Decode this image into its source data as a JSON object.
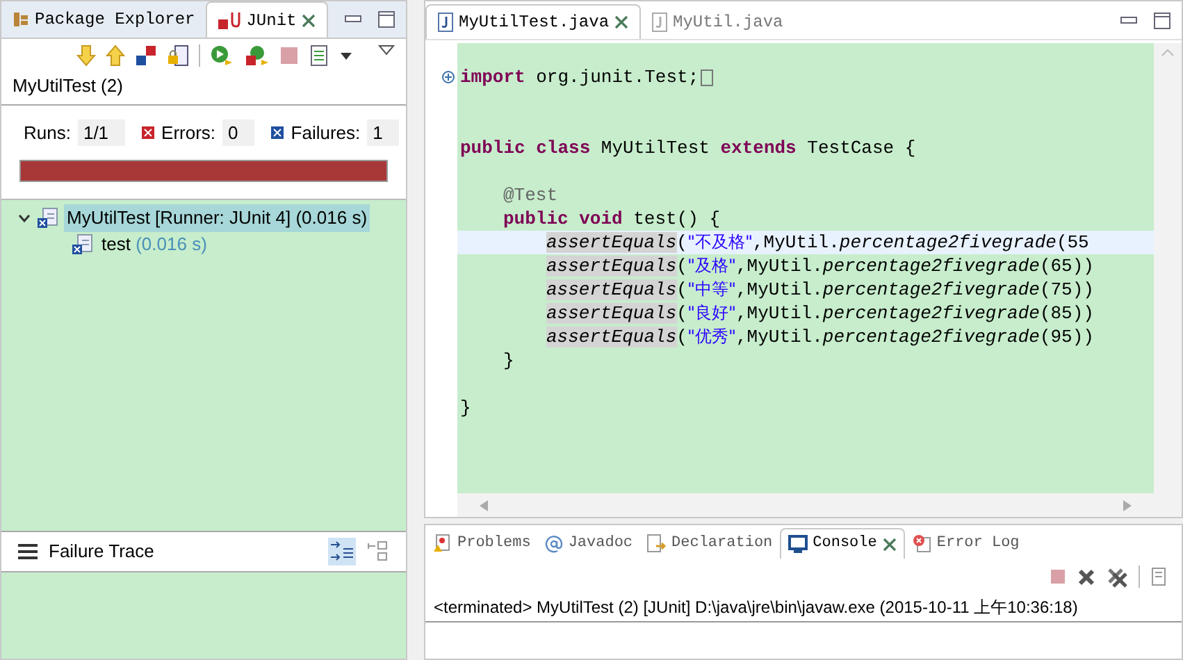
{
  "left_tabs": [
    {
      "label": "Package Explorer",
      "selected": false,
      "kind": "package"
    },
    {
      "label": "JUnit",
      "selected": true,
      "kind": "junit"
    }
  ],
  "junit": {
    "title": "MyUtilTest (2)",
    "counters": [
      {
        "label": "Runs:",
        "value": "1/1",
        "kind": "plain"
      },
      {
        "label": "Errors:",
        "value": "0",
        "kind": "error"
      },
      {
        "label": "Failures:",
        "value": "1",
        "kind": "failure"
      }
    ],
    "progress": {
      "level": 1,
      "failed": true
    },
    "tree": [
      {
        "label": "MyUtilTest [Runner: JUnit 4] (0.016 s)",
        "selected": true,
        "expanded": true,
        "children": [
          {
            "label": "test",
            "time": "(0.016 s)",
            "selected": false
          }
        ]
      }
    ],
    "failure_trace": {
      "title": "Failure Trace"
    }
  },
  "editor_tabs": [
    {
      "label": "MyUtilTest.java",
      "selected": true
    },
    {
      "label": "MyUtil.java",
      "selected": false
    }
  ],
  "code_lines": [
    {
      "kind": "code",
      "current": false,
      "folded": true,
      "tokens": [
        {
          "text": "import",
          "kind": "keyword"
        },
        {
          "text": " org.junit.Test;",
          "kind": "plain"
        }
      ]
    },
    {
      "kind": "blank"
    },
    {
      "kind": "blank"
    },
    {
      "kind": "code",
      "current": false,
      "tokens": [
        {
          "text": "public class",
          "kind": "keyword"
        },
        {
          "text": " MyUtilTest ",
          "kind": "plain"
        },
        {
          "text": "extends",
          "kind": "keyword"
        },
        {
          "text": " TestCase {",
          "kind": "plain"
        }
      ],
      "children": [
        {
          "kind": "blank"
        },
        {
          "kind": "code",
          "current": false,
          "tokens": [
            {
              "text": "@Test",
              "kind": "annotation"
            }
          ]
        },
        {
          "kind": "code",
          "current": false,
          "tokens": [
            {
              "text": "public void",
              "kind": "keyword"
            },
            {
              "text": " test() {",
              "kind": "plain"
            }
          ],
          "children": [
            {
              "kind": "code",
              "current": true,
              "tokens": [
                {
                  "text": "assertEquals",
                  "kind": "static"
                },
                {
                  "text": "(",
                  "kind": "plain"
                },
                {
                  "text": "\"不及格\"",
                  "kind": "string"
                },
                {
                  "text": ",MyUtil.",
                  "kind": "plain"
                },
                {
                  "text": "percentage2fivegrade",
                  "kind": "method"
                },
                {
                  "text": "(55",
                  "kind": "plain"
                }
              ]
            },
            {
              "kind": "code",
              "current": false,
              "tokens": [
                {
                  "text": "assertEquals",
                  "kind": "static"
                },
                {
                  "text": "(",
                  "kind": "plain"
                },
                {
                  "text": "\"及格\"",
                  "kind": "string"
                },
                {
                  "text": ",MyUtil.",
                  "kind": "plain"
                },
                {
                  "text": "percentage2fivegrade",
                  "kind": "method"
                },
                {
                  "text": "(65))",
                  "kind": "plain"
                }
              ]
            },
            {
              "kind": "code",
              "current": false,
              "tokens": [
                {
                  "text": "assertEquals",
                  "kind": "static"
                },
                {
                  "text": "(",
                  "kind": "plain"
                },
                {
                  "text": "\"中等\"",
                  "kind": "string"
                },
                {
                  "text": ",MyUtil.",
                  "kind": "plain"
                },
                {
                  "text": "percentage2fivegrade",
                  "kind": "method"
                },
                {
                  "text": "(75))",
                  "kind": "plain"
                }
              ]
            },
            {
              "kind": "code",
              "current": false,
              "tokens": [
                {
                  "text": "assertEquals",
                  "kind": "static"
                },
                {
                  "text": "(",
                  "kind": "plain"
                },
                {
                  "text": "\"良好\"",
                  "kind": "string"
                },
                {
                  "text": ",MyUtil.",
                  "kind": "plain"
                },
                {
                  "text": "percentage2fivegrade",
                  "kind": "method"
                },
                {
                  "text": "(85))",
                  "kind": "plain"
                }
              ]
            },
            {
              "kind": "code",
              "current": false,
              "tokens": [
                {
                  "text": "assertEquals",
                  "kind": "static"
                },
                {
                  "text": "(",
                  "kind": "plain"
                },
                {
                  "text": "\"优秀\"",
                  "kind": "string"
                },
                {
                  "text": ",MyUtil.",
                  "kind": "plain"
                },
                {
                  "text": "percentage2fivegrade",
                  "kind": "method"
                },
                {
                  "text": "(95))",
                  "kind": "plain"
                }
              ]
            }
          ]
        },
        {
          "kind": "code",
          "current": false,
          "tokens": [
            {
              "text": "}",
              "kind": "plain"
            }
          ]
        }
      ]
    },
    {
      "kind": "blank"
    },
    {
      "kind": "code",
      "current": false,
      "tokens": [
        {
          "text": "}",
          "kind": "plain"
        }
      ]
    }
  ],
  "bottom_tabs": [
    {
      "label": "Problems",
      "selected": false,
      "kind": "problems"
    },
    {
      "label": "Javadoc",
      "selected": false,
      "kind": "javadoc"
    },
    {
      "label": "Declaration",
      "selected": false,
      "kind": "declaration"
    },
    {
      "label": "Console",
      "selected": true,
      "kind": "console"
    },
    {
      "label": "Error Log",
      "selected": false,
      "kind": "errorlog"
    }
  ],
  "console": {
    "text": "<terminated> MyUtilTest (2) [JUnit] D:\\java\\jre\\bin\\javaw.exe (2015-10-11 上午10:36:18)"
  }
}
